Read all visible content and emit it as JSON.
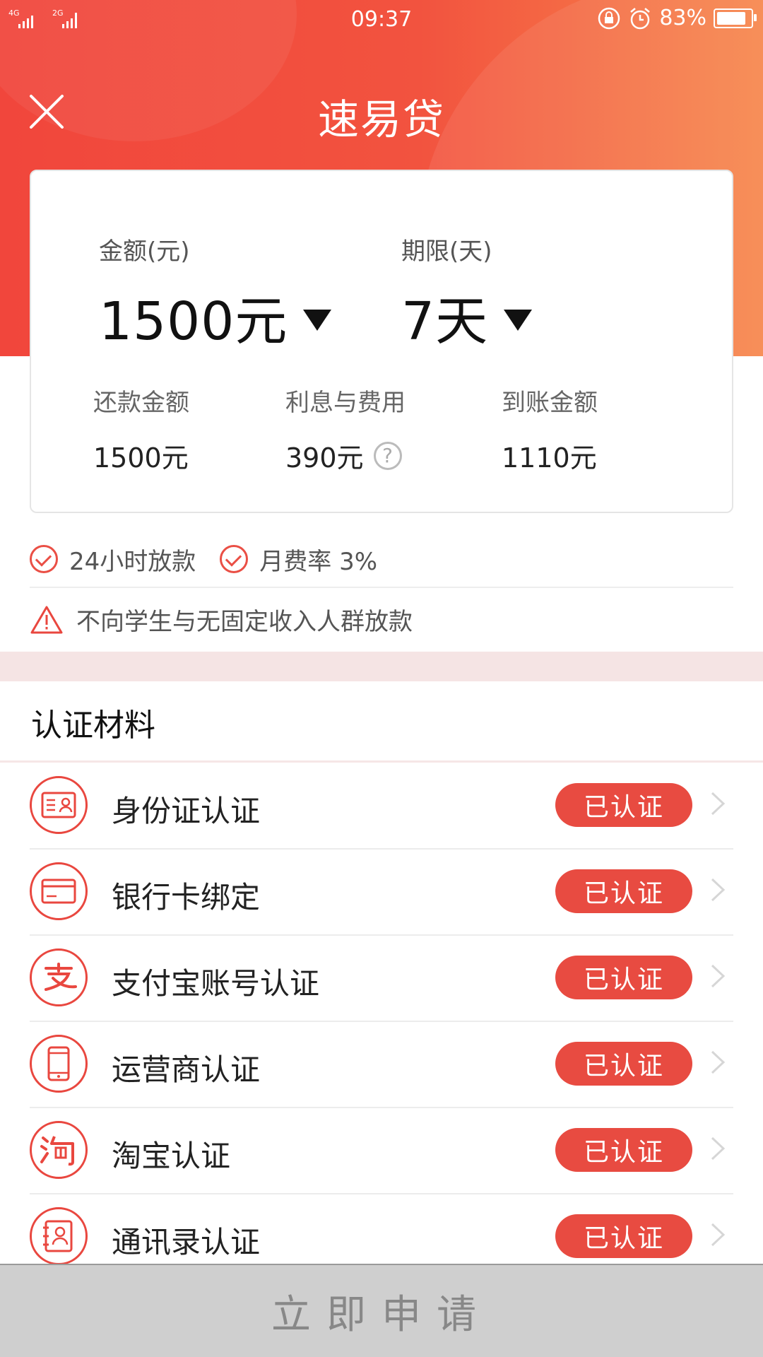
{
  "status_bar": {
    "network_1": "4G",
    "network_2": "2G",
    "time": "09:37",
    "battery": "83%"
  },
  "header": {
    "title": "速易贷"
  },
  "loan": {
    "amount_label": "金额(元)",
    "amount_value": "1500元",
    "term_label": "期限(天)",
    "term_value": "7天",
    "summary": [
      {
        "label": "还款金额",
        "value": "1500元"
      },
      {
        "label": "利息与费用",
        "value": "390元"
      },
      {
        "label": "到账金额",
        "value": "1110元"
      }
    ]
  },
  "features": [
    {
      "text": "24小时放款"
    },
    {
      "text": "月费率 3%"
    }
  ],
  "warning": {
    "text": "不向学生与无固定收入人群放款"
  },
  "section": {
    "title": "认证材料"
  },
  "items": [
    {
      "name": "身份证认证",
      "icon": "id-card-icon",
      "status": "已认证"
    },
    {
      "name": "银行卡绑定",
      "icon": "bank-card-icon",
      "status": "已认证"
    },
    {
      "name": "支付宝账号认证",
      "icon": "alipay-icon",
      "status": "已认证"
    },
    {
      "name": "运营商认证",
      "icon": "phone-icon",
      "status": "已认证"
    },
    {
      "name": "淘宝认证",
      "icon": "taobao-icon",
      "status": "已认证"
    },
    {
      "name": "通讯录认证",
      "icon": "contacts-icon",
      "status": "已认证"
    }
  ],
  "cta": {
    "label": "立即申请"
  },
  "colors": {
    "accent": "#e84b41",
    "header_start": "#f1463c",
    "header_end": "#f7864b",
    "disabled_button": "#cfcfcf"
  }
}
